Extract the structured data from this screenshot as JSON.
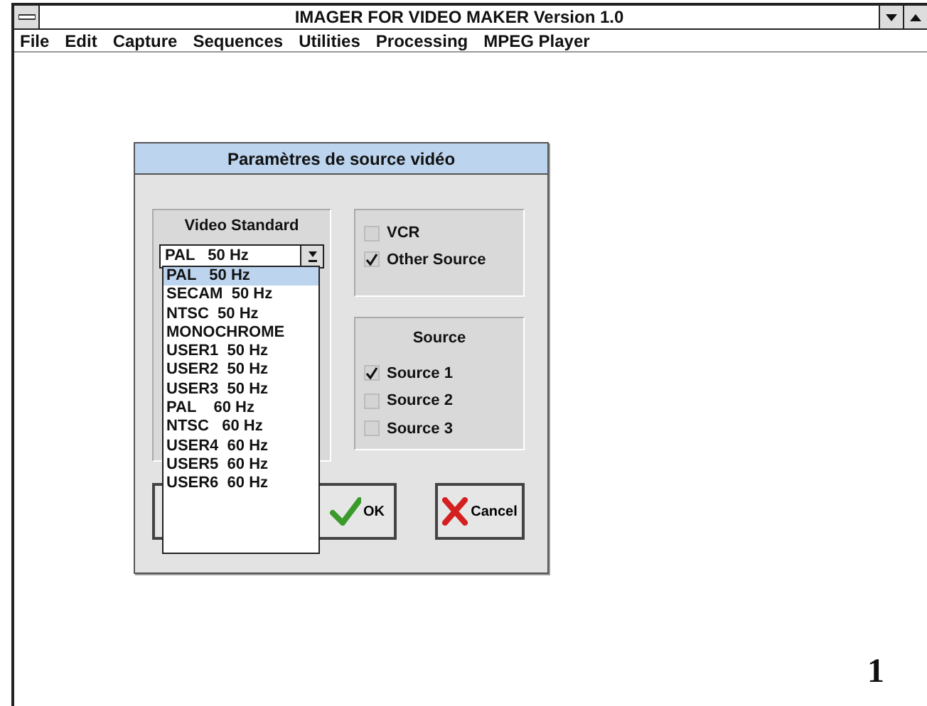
{
  "window": {
    "title": "IMAGER FOR VIDEO MAKER Version 1.0"
  },
  "menu": [
    {
      "label": "File"
    },
    {
      "label": "Edit"
    },
    {
      "label": "Capture"
    },
    {
      "label": "Sequences"
    },
    {
      "label": "Utilities"
    },
    {
      "label": "Processing"
    },
    {
      "label": "MPEG Player"
    }
  ],
  "dialog": {
    "title": "Paramètres de source vidéo",
    "video_standard": {
      "label": "Video Standard",
      "value": "PAL   50 Hz",
      "expanded": true,
      "options": [
        {
          "label": "PAL   50 Hz",
          "selected": true
        },
        {
          "label": "SECAM  50 Hz",
          "selected": false
        },
        {
          "label": "NTSC  50 Hz",
          "selected": false
        },
        {
          "label": "MONOCHROME",
          "selected": false
        },
        {
          "label": "USER1  50 Hz",
          "selected": false
        },
        {
          "label": "USER2  50 Hz",
          "selected": false
        },
        {
          "label": "USER3  50 Hz",
          "selected": false
        },
        {
          "label": "PAL    60 Hz",
          "selected": false
        },
        {
          "label": "NTSC   60 Hz",
          "selected": false
        },
        {
          "label": "USER4  60 Hz",
          "selected": false
        },
        {
          "label": "USER5  60 Hz",
          "selected": false
        },
        {
          "label": "USER6  60 Hz",
          "selected": false
        }
      ]
    },
    "input_options": [
      {
        "label": "VCR",
        "checked": false
      },
      {
        "label": "Other Source",
        "checked": true
      }
    ],
    "source_group": {
      "title": "Source",
      "options": [
        {
          "label": "Source 1",
          "checked": true
        },
        {
          "label": "Source 2",
          "checked": false
        },
        {
          "label": "Source 3",
          "checked": false
        }
      ]
    },
    "buttons": [
      {
        "kind": "blank"
      },
      {
        "kind": "ok",
        "label": "OK"
      },
      {
        "kind": "cancel",
        "label": "Cancel"
      }
    ]
  },
  "figure_label": "1"
}
